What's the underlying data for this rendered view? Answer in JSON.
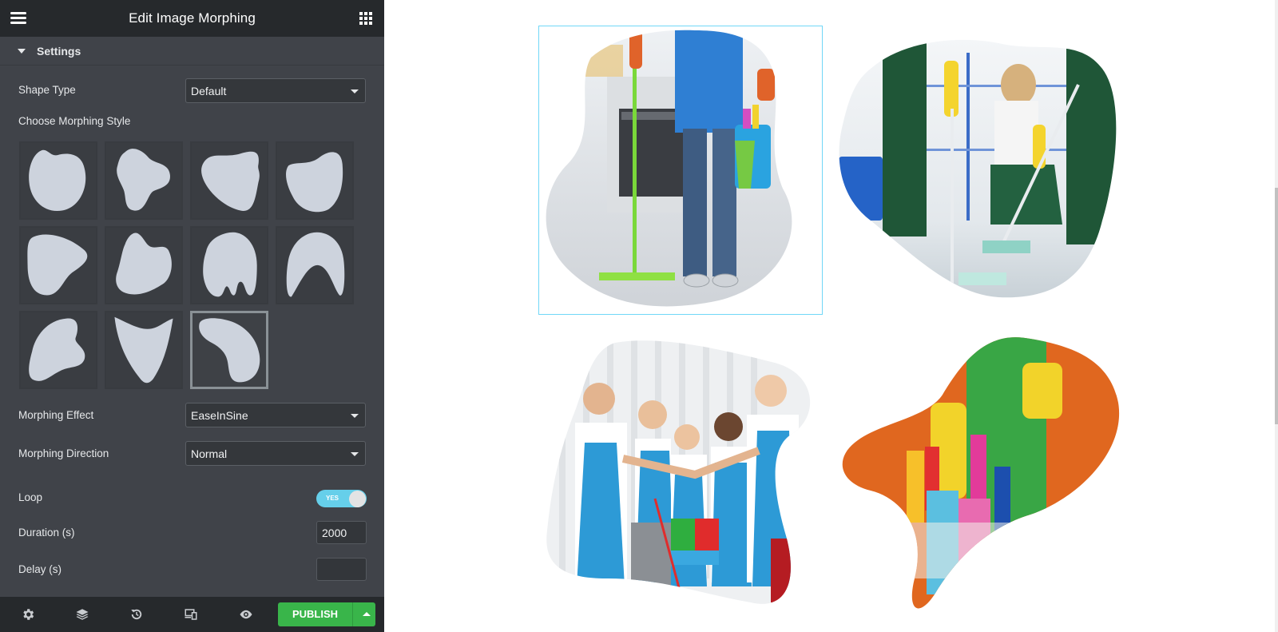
{
  "panel": {
    "title": "Edit Image Morphing",
    "menu_icon": "hamburger-icon",
    "apps_icon": "grid-icon",
    "section": {
      "label": "Settings",
      "icon": "caret-down-icon",
      "expanded": true
    },
    "shape_type": {
      "label": "Shape Type",
      "value": "Default"
    },
    "morph_style": {
      "label": "Choose Morphing Style",
      "shapes": [
        {
          "name": "blob-1"
        },
        {
          "name": "blob-2"
        },
        {
          "name": "blob-3"
        },
        {
          "name": "blob-4"
        },
        {
          "name": "blob-5"
        },
        {
          "name": "blob-6"
        },
        {
          "name": "blob-7"
        },
        {
          "name": "blob-8"
        },
        {
          "name": "blob-9"
        },
        {
          "name": "blob-10"
        },
        {
          "name": "blob-11"
        }
      ],
      "selected_index": 10
    },
    "morph_effect": {
      "label": "Morphing Effect",
      "value": "EaseInSine"
    },
    "morph_direction": {
      "label": "Morphing Direction",
      "value": "Normal"
    },
    "loop": {
      "label": "Loop",
      "value": true,
      "on_text": "YES"
    },
    "duration": {
      "label": "Duration (s)",
      "value": "2000"
    },
    "delay": {
      "label": "Delay (s)",
      "value": ""
    }
  },
  "footer": {
    "icons": [
      "settings-icon",
      "layers-icon",
      "history-icon",
      "responsive-icon",
      "preview-eye-icon"
    ],
    "publish_label": "PUBLISH"
  },
  "colors": {
    "panel_bg": "#404349",
    "header_bg": "#26292c",
    "accent": "#66cfea",
    "publish": "#39b54a",
    "shape_fill": "#cdd3dd",
    "selection_frame": "#71d7f7"
  },
  "canvas": {
    "images": [
      {
        "name": "mop-cleaner-image",
        "description": "person with mop and bucket in kitchen",
        "selected": true
      },
      {
        "name": "team-mopping-image",
        "description": "cleaners in green uniforms mopping floor",
        "selected": false
      },
      {
        "name": "cleaning-crew-image",
        "description": "team in blue aprons stacking hands",
        "selected": false
      },
      {
        "name": "supplies-basket-image",
        "description": "person in green apron with cleaning supplies on orange",
        "selected": false
      }
    ]
  }
}
